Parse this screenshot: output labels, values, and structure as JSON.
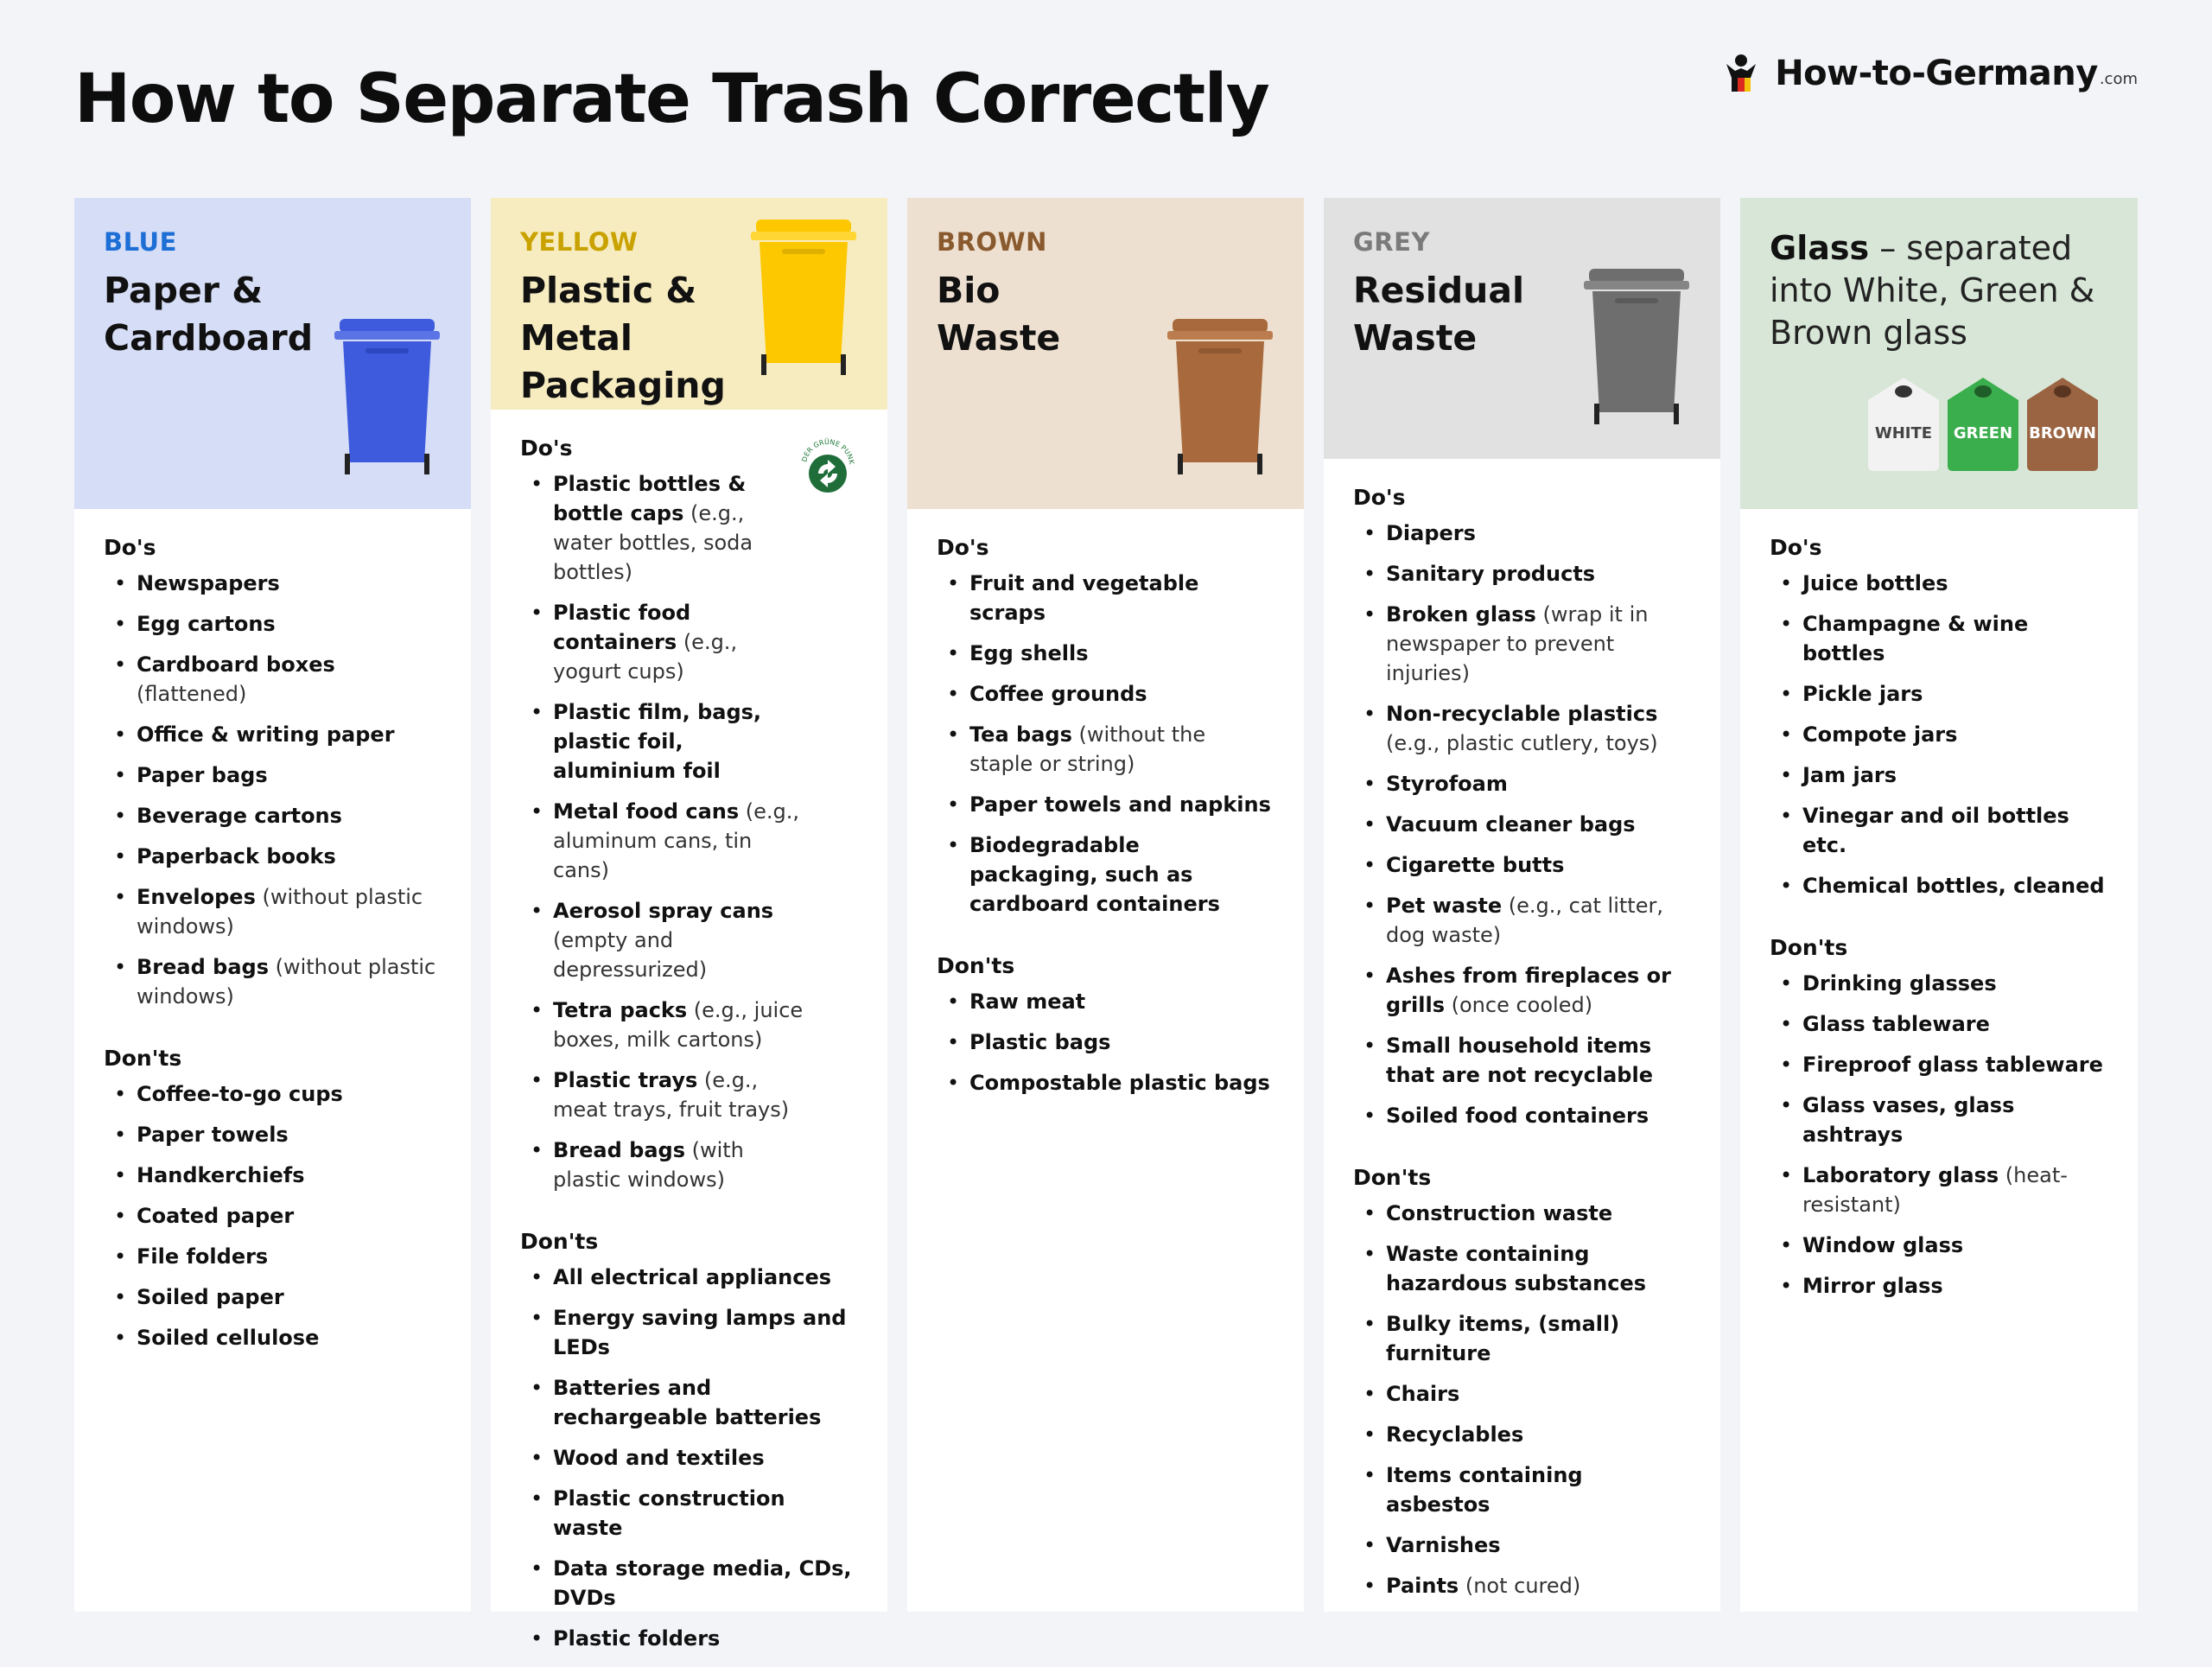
{
  "title": "How to Separate Trash Correctly",
  "brand": {
    "name": "How-to-Germany",
    "suffix": ".com",
    "icon": "person-logo-icon"
  },
  "colors": {
    "blue": "#3d5bdc",
    "yellow": "#fdc800",
    "brown": "#a86a3c",
    "grey": "#6e6e6e",
    "glass_white": "#f2f2f2",
    "glass_green": "#3aad4c",
    "glass_brown": "#9a6442"
  },
  "columns": [
    {
      "color_label": "BLUE",
      "title": "Paper & Cardboard",
      "dos_title": "Do's",
      "dos": [
        {
          "main": "Newspapers",
          "note": ""
        },
        {
          "main": "Egg cartons",
          "note": ""
        },
        {
          "main": "Cardboard boxes",
          "note": " (flattened)"
        },
        {
          "main": "Office & writing paper",
          "note": ""
        },
        {
          "main": "Paper bags",
          "note": ""
        },
        {
          "main": "Beverage cartons",
          "note": ""
        },
        {
          "main": "Paperback books",
          "note": ""
        },
        {
          "main": "Envelopes",
          "note": " (without plastic windows)"
        },
        {
          "main": "Bread bags",
          "note": " (without plastic windows)"
        }
      ],
      "donts_title": "Don'ts",
      "donts": [
        {
          "main": "Coffee-to-go cups",
          "note": ""
        },
        {
          "main": "Paper towels",
          "note": ""
        },
        {
          "main": "Handkerchiefs",
          "note": ""
        },
        {
          "main": "Coated paper",
          "note": ""
        },
        {
          "main": "File folders",
          "note": ""
        },
        {
          "main": "Soiled paper",
          "note": ""
        },
        {
          "main": "Soiled cellulose",
          "note": ""
        }
      ]
    },
    {
      "color_label": "YELLOW",
      "title": "Plastic & Metal Packaging",
      "logo_text": "DER GRÜNE PUNKT",
      "dos_title": "Do's",
      "dos": [
        {
          "main": "Plastic bottles & bottle caps",
          "note": " (e.g., water bottles, soda bottles)"
        },
        {
          "main": "Plastic food containers",
          "note": " (e.g., yogurt cups)"
        },
        {
          "main": "Plastic film, bags, plastic foil, aluminium foil",
          "note": ""
        },
        {
          "main": "Metal food cans",
          "note": " (e.g., aluminum cans, tin cans)"
        },
        {
          "main": "Aerosol spray cans",
          "note": " (empty and depressurized)"
        },
        {
          "main": "Tetra packs",
          "note": " (e.g., juice boxes, milk cartons)"
        },
        {
          "main": "Plastic trays",
          "note": " (e.g., meat trays, fruit trays)"
        },
        {
          "main": "Bread bags",
          "note": " (with plastic windows)"
        }
      ],
      "donts_title": "Don'ts",
      "donts": [
        {
          "main": "All electrical appliances",
          "note": ""
        },
        {
          "main": "Energy saving lamps and LEDs",
          "note": ""
        },
        {
          "main": "Batteries and rechargeable batteries",
          "note": ""
        },
        {
          "main": "Wood and textiles",
          "note": ""
        },
        {
          "main": "Plastic construction waste",
          "note": ""
        },
        {
          "main": "Data storage media, CDs, DVDs",
          "note": ""
        },
        {
          "main": "Plastic folders",
          "note": ""
        }
      ]
    },
    {
      "color_label": "BROWN",
      "title": "Bio Waste",
      "dos_title": "Do's",
      "dos": [
        {
          "main": "Fruit and vegetable scraps",
          "note": ""
        },
        {
          "main": "Egg shells",
          "note": ""
        },
        {
          "main": "Coffee grounds",
          "note": ""
        },
        {
          "main": "Tea bags",
          "note": " (without the staple or string)"
        },
        {
          "main": "Paper towels and napkins",
          "note": ""
        },
        {
          "main": "Biodegradable packaging, such as cardboard containers",
          "note": ""
        }
      ],
      "donts_title": "Don'ts",
      "donts": [
        {
          "main": "Raw meat",
          "note": ""
        },
        {
          "main": "Plastic bags",
          "note": ""
        },
        {
          "main": "Compostable plastic bags",
          "note": ""
        }
      ]
    },
    {
      "color_label": "GREY",
      "title": "Residual Waste",
      "dos_title": "Do's",
      "dos": [
        {
          "main": "Diapers",
          "note": ""
        },
        {
          "main": "Sanitary products",
          "note": ""
        },
        {
          "main": "Broken glass",
          "note": " (wrap it in newspaper to prevent injuries)"
        },
        {
          "main": "Non-recyclable plastics",
          "note": " (e.g., plastic cutlery, toys)"
        },
        {
          "main": "Styrofoam",
          "note": ""
        },
        {
          "main": "Vacuum cleaner bags",
          "note": ""
        },
        {
          "main": "Cigarette butts",
          "note": ""
        },
        {
          "main": "Pet waste",
          "note": " (e.g., cat litter, dog waste)"
        },
        {
          "main": "Ashes from fireplaces or grills",
          "note": " (once cooled)"
        },
        {
          "main": "Small household items that are not recyclable",
          "note": ""
        },
        {
          "main": "Soiled food containers",
          "note": ""
        }
      ],
      "donts_title": "Don'ts",
      "donts": [
        {
          "main": "Construction waste",
          "note": ""
        },
        {
          "main": "Waste containing hazardous substances",
          "note": ""
        },
        {
          "main": "Bulky items, (small) furniture",
          "note": ""
        },
        {
          "main": "Chairs",
          "note": ""
        },
        {
          "main": "Recyclables",
          "note": ""
        },
        {
          "main": "Items containing asbestos",
          "note": ""
        },
        {
          "main": "Varnishes",
          "note": ""
        },
        {
          "main": "Paints",
          "note": " (not cured)"
        }
      ]
    },
    {
      "title_strong": "Glass",
      "title_rest": " – separated into White, Green & Brown glass",
      "container_labels": [
        "WHITE",
        "GREEN",
        "BROWN"
      ],
      "dos_title": "Do's",
      "dos": [
        {
          "main": "Juice bottles",
          "note": ""
        },
        {
          "main": "Champagne & wine bottles",
          "note": ""
        },
        {
          "main": "Pickle jars",
          "note": ""
        },
        {
          "main": "Compote jars",
          "note": ""
        },
        {
          "main": "Jam jars",
          "note": ""
        },
        {
          "main": "Vinegar and oil bottles etc.",
          "note": ""
        },
        {
          "main": "Chemical bottles, cleaned",
          "note": ""
        }
      ],
      "donts_title": "Don'ts",
      "donts": [
        {
          "main": "Drinking glasses",
          "note": ""
        },
        {
          "main": "Glass tableware",
          "note": ""
        },
        {
          "main": "Fireproof glass tableware",
          "note": ""
        },
        {
          "main": "Glass vases, glass ashtrays",
          "note": ""
        },
        {
          "main": "Laboratory glass",
          "note": " (heat-resistant)"
        },
        {
          "main": "Window glass",
          "note": ""
        },
        {
          "main": "Mirror glass",
          "note": ""
        }
      ]
    }
  ]
}
